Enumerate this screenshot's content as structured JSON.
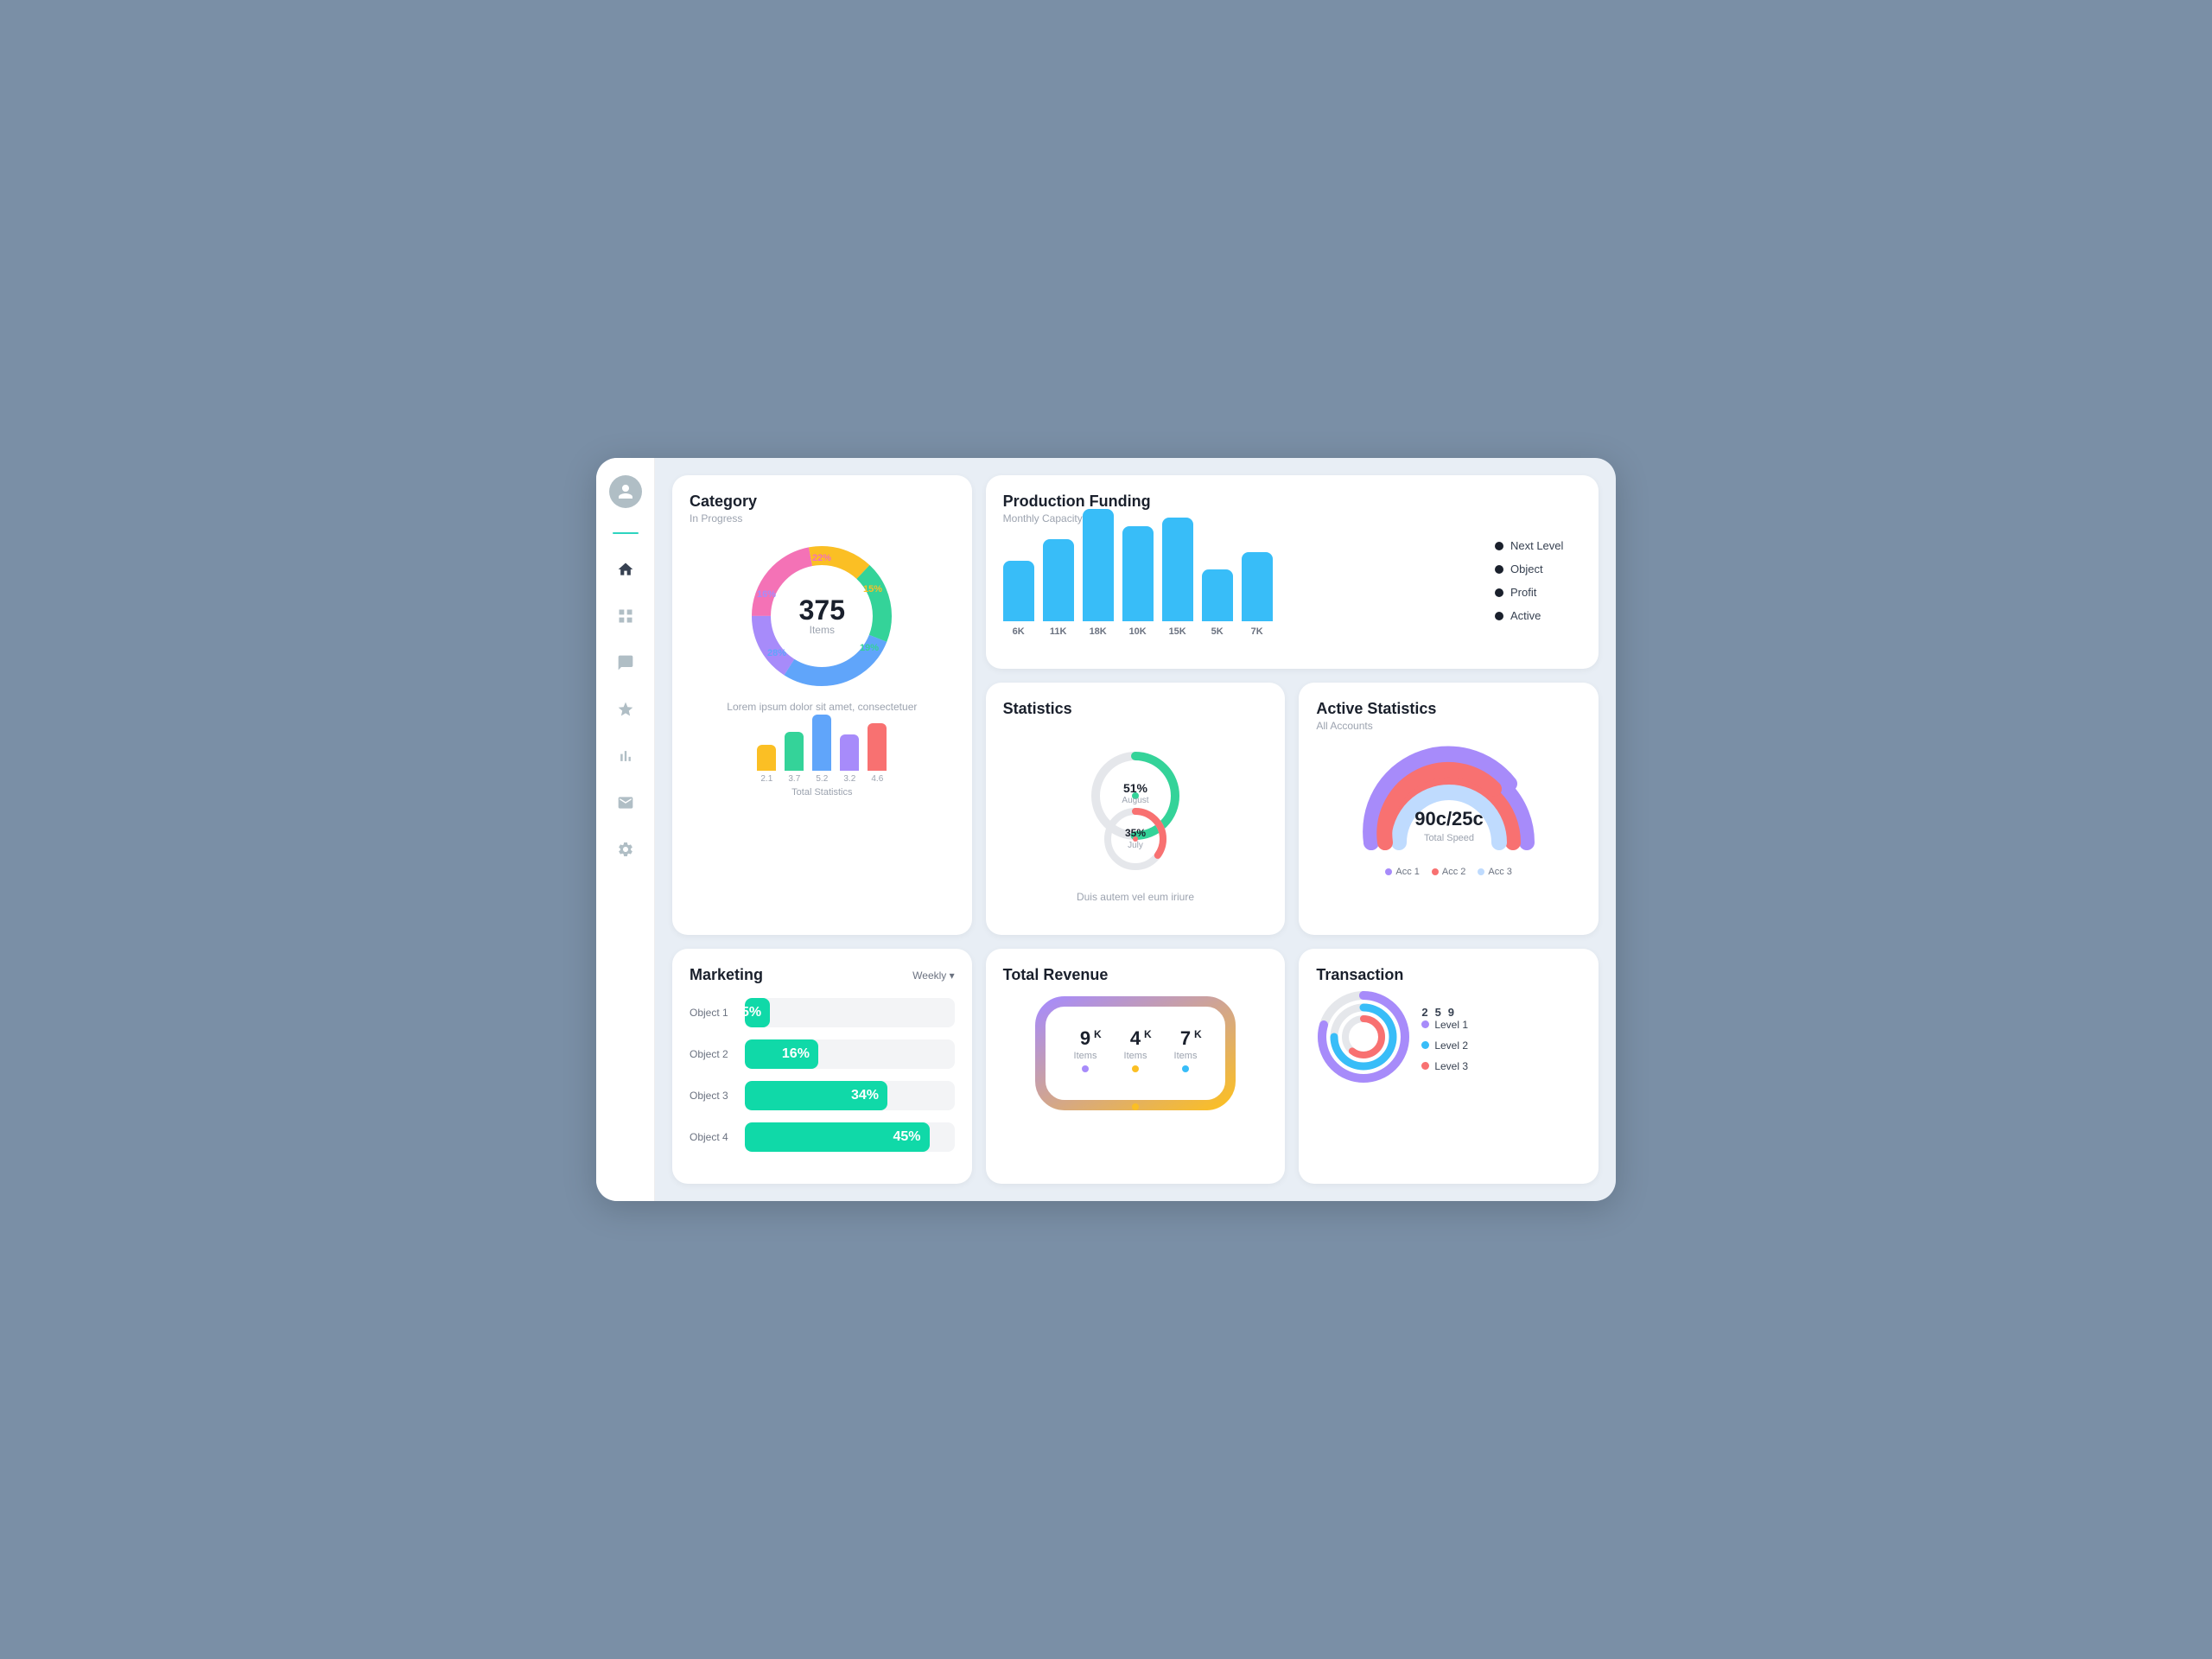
{
  "sidebar": {
    "icons": [
      "user",
      "home",
      "grid",
      "chat",
      "star",
      "chart",
      "mail",
      "settings"
    ]
  },
  "category": {
    "title": "Category",
    "subtitle": "In Progress",
    "donut_center_value": "375",
    "donut_center_label": "Items",
    "segments": [
      {
        "label": "22%",
        "color": "#f472b6",
        "value": 22
      },
      {
        "label": "15%",
        "color": "#fbbf24",
        "value": 15
      },
      {
        "label": "19%",
        "color": "#34d399",
        "value": 19
      },
      {
        "label": "28%",
        "color": "#60a5fa",
        "value": 28
      },
      {
        "label": "16%",
        "color": "#a78bfa",
        "value": 16
      }
    ],
    "lorem": "Lorem ipsum dolor sit amet, consectetuer",
    "bars": [
      {
        "label": "2.1",
        "height": 30,
        "color": "#fbbf24"
      },
      {
        "label": "3.7",
        "height": 45,
        "color": "#34d399"
      },
      {
        "label": "5.2",
        "height": 65,
        "color": "#60a5fa"
      },
      {
        "label": "3.2",
        "height": 42,
        "color": "#a78bfa"
      },
      {
        "label": "4.6",
        "height": 55,
        "color": "#f87171"
      }
    ],
    "bars_title": "Total Statistics"
  },
  "production": {
    "title": "Production Funding",
    "subtitle": "Monthly Capacity",
    "bars": [
      {
        "label": "6K",
        "height": 70
      },
      {
        "label": "11K",
        "height": 95
      },
      {
        "label": "18K",
        "height": 130
      },
      {
        "label": "10K",
        "height": 110
      },
      {
        "label": "15K",
        "height": 120
      },
      {
        "label": "5K",
        "height": 60
      },
      {
        "label": "7K",
        "height": 80
      }
    ],
    "bar_color": "#38bdf8",
    "legend": [
      {
        "label": "Next Level",
        "color": "#1a202c"
      },
      {
        "label": "Object",
        "color": "#1a202c"
      },
      {
        "label": "Profit",
        "color": "#1a202c"
      },
      {
        "label": "Active",
        "color": "#1a202c"
      }
    ]
  },
  "statistics": {
    "title": "Statistics",
    "upper_value": "51%",
    "upper_label": "August",
    "lower_value": "35%",
    "lower_label": "July",
    "upper_color": "#34d399",
    "lower_color": "#f87171",
    "desc": "Duis autem vel eum iriure"
  },
  "active_stats": {
    "title": "Active Statistics",
    "subtitle": "All Accounts",
    "speed_value": "90c/25c",
    "speed_label": "Total Speed",
    "legend": [
      {
        "label": "Acc 1",
        "color": "#a78bfa"
      },
      {
        "label": "Acc 2",
        "color": "#f87171"
      },
      {
        "label": "Acc 3",
        "color": "#bfdbfe"
      }
    ],
    "arc_colors": [
      "#a78bfa",
      "#f87171",
      "#bfdbfe"
    ]
  },
  "marketing": {
    "title": "Marketing",
    "dropdown": "Weekly ▾",
    "rows": [
      {
        "label": "Object 1",
        "value": "5%",
        "percent": 12
      },
      {
        "label": "Object 2",
        "value": "16%",
        "percent": 35
      },
      {
        "label": "Object 3",
        "value": "34%",
        "percent": 68
      },
      {
        "label": "Object 4",
        "value": "45%",
        "percent": 88
      }
    ]
  },
  "revenue": {
    "title": "Total Revenue",
    "items": [
      {
        "value": "9",
        "sub": "K",
        "label": "Items"
      },
      {
        "value": "4",
        "sub": "K",
        "label": "Items"
      },
      {
        "value": "7",
        "sub": "K",
        "label": "Items"
      }
    ],
    "border_colors": [
      "#a78bfa",
      "#fbbf24"
    ],
    "dot_colors": [
      "#a78bfa",
      "#fbbf24",
      "#38bdf8"
    ]
  },
  "transaction": {
    "title": "Transaction",
    "legend": [
      {
        "label": "Level 1",
        "color": "#a78bfa"
      },
      {
        "label": "Level 2",
        "color": "#38bdf8"
      },
      {
        "label": "Level 3",
        "color": "#f87171"
      }
    ],
    "numbers": [
      "2",
      "5",
      "9"
    ],
    "ring_colors": [
      "#a78bfa",
      "#38bdf8",
      "#f87171"
    ]
  }
}
